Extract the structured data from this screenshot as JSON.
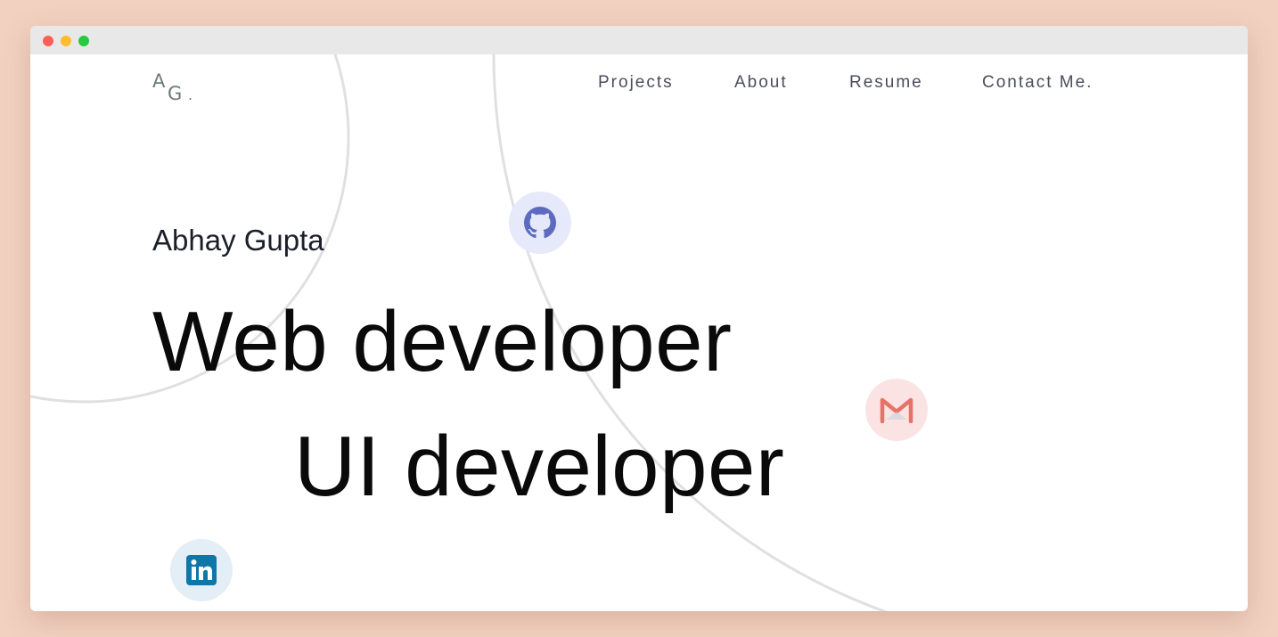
{
  "window": {
    "controls": [
      "close",
      "minimize",
      "maximize"
    ]
  },
  "logo": {
    "letter_a": "A",
    "letter_g": "G",
    "dot": "."
  },
  "nav": {
    "links": [
      {
        "label": "Projects"
      },
      {
        "label": "About"
      },
      {
        "label": "Resume"
      },
      {
        "label": "Contact Me."
      }
    ]
  },
  "hero": {
    "name": "Abhay Gupta",
    "roles": [
      "Web developer",
      "UI developer"
    ]
  },
  "social": {
    "github": {
      "icon": "github-icon",
      "color": "#5c6bc0"
    },
    "gmail": {
      "icon": "gmail-icon",
      "color": "#e57368"
    },
    "linkedin": {
      "icon": "linkedin-icon",
      "color": "#0e76a8"
    }
  },
  "colors": {
    "page_bg": "#f2d1c0",
    "window_bg": "#ffffff",
    "titlebar": "#e8e8e8",
    "nav_text": "#4a4d5c",
    "decor_lines": "#e0e0e0"
  }
}
